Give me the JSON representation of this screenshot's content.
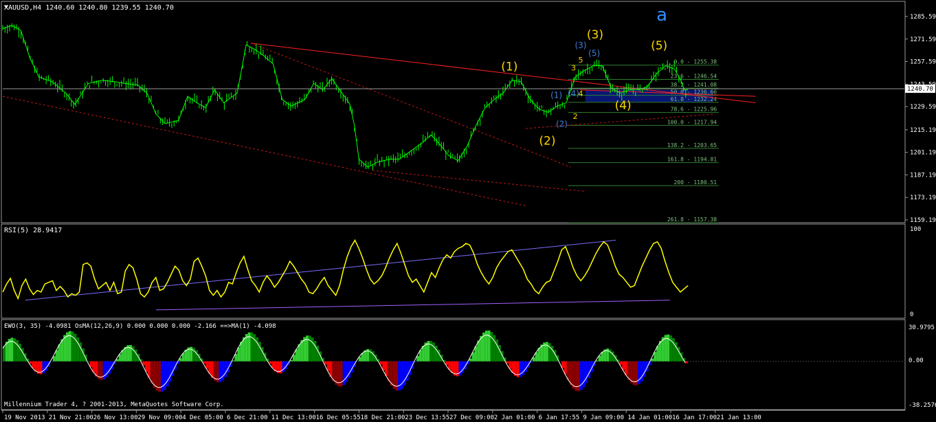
{
  "colors": {
    "background": "#000000",
    "frame": "#9a9a9a",
    "grid_text": "#ffffff",
    "bull_candle": "#00ff00",
    "price_line": "#9a9a9a",
    "trend_solid": "#ff2020",
    "trend_dashed": "#c01818",
    "fib": "#2f7f2f",
    "fib_label": "#7fbf7f",
    "wave_yellow": "#ffd700",
    "wave_blue": "#3f7fdf",
    "wave_a": "#2f8fff",
    "rsi_line": "#ffff00",
    "rsi_trend_upper": "#7a6cff",
    "rsi_trend_lower": "#a060ff",
    "ewo_bright_green": "#32cd32",
    "ewo_dark_green": "#008000",
    "ewo_blue": "#0000ff",
    "ewo_red": "#ff0000",
    "ewo_dark_red": "#8b0000",
    "ewo_signal": "#ffffff",
    "fib_zone": "#0a1a80"
  },
  "main_panel": {
    "title": "XAUUSD,H4  1240.60 1240.80 1239.55 1240.70",
    "current_price": "1240.70",
    "y_axis_ticks": [
      "1285.59",
      "1271.59",
      "1257.59",
      "1243.59",
      "1229.59",
      "1215.19",
      "1201.19",
      "1187.19",
      "1173.19",
      "1159.19"
    ],
    "fib_levels": [
      {
        "label": "0.0 - 1255.38",
        "price": 1255.38
      },
      {
        "label": "23.6 - 1246.54",
        "price": 1246.54
      },
      {
        "label": "38.2 - 1241.08",
        "price": 1241.08
      },
      {
        "label": "50.0 - 1236.66",
        "price": 1236.66
      },
      {
        "label": "61.8 - 1232.24",
        "price": 1232.24
      },
      {
        "label": "78.6 - 1225.96",
        "price": 1225.96
      },
      {
        "label": "100.0 - 1217.94",
        "price": 1217.94
      },
      {
        "label": "138.2 - 1203.65",
        "price": 1203.65
      },
      {
        "label": "161.8 - 1194.81",
        "price": 1194.81
      },
      {
        "label": "200 - 1180.51",
        "price": 1180.51
      },
      {
        "label": "261.8 - 1157.38",
        "price": 1157.38
      }
    ],
    "wave_labels": [
      {
        "text": "(1)",
        "style": "yellow",
        "price": 1252,
        "bar": 0.562
      },
      {
        "text": "(2)",
        "style": "yellow",
        "price": 1206,
        "bar": 0.604
      },
      {
        "text": "(3)",
        "style": "yellow",
        "price": 1272,
        "bar": 0.657
      },
      {
        "text": "(4)",
        "style": "yellow",
        "price": 1228,
        "bar": 0.688
      },
      {
        "text": "(5)",
        "style": "yellow",
        "price": 1265,
        "bar": 0.728
      },
      {
        "text": "a",
        "style": "a",
        "price": 1283,
        "bar": 0.731
      },
      {
        "text": "(3)",
        "style": "blue",
        "price": 1266,
        "bar": 0.641
      },
      {
        "text": "(5)",
        "style": "blue",
        "price": 1261,
        "bar": 0.656
      },
      {
        "text": "(1)",
        "style": "blue",
        "price": 1235,
        "bar": 0.614
      },
      {
        "text": "(2)",
        "style": "blue",
        "price": 1217,
        "bar": 0.62
      },
      {
        "text": "(4)",
        "style": "blue",
        "price": 1236,
        "bar": 0.633
      },
      {
        "text": "3",
        "style": "small",
        "price": 1252,
        "bar": 0.633
      },
      {
        "text": "5",
        "style": "small",
        "price": 1257,
        "bar": 0.641
      },
      {
        "text": "4",
        "style": "small",
        "price": 1236,
        "bar": 0.641
      },
      {
        "text": "2",
        "style": "small",
        "price": 1222,
        "bar": 0.635
      }
    ],
    "price_path": [
      [
        0.0,
        1278
      ],
      [
        0.01,
        1280
      ],
      [
        0.02,
        1277
      ],
      [
        0.03,
        1260
      ],
      [
        0.04,
        1248
      ],
      [
        0.055,
        1245
      ],
      [
        0.07,
        1238
      ],
      [
        0.08,
        1231
      ],
      [
        0.095,
        1244
      ],
      [
        0.11,
        1246
      ],
      [
        0.125,
        1245
      ],
      [
        0.135,
        1244
      ],
      [
        0.15,
        1243
      ],
      [
        0.16,
        1238
      ],
      [
        0.17,
        1225
      ],
      [
        0.18,
        1219
      ],
      [
        0.195,
        1221
      ],
      [
        0.205,
        1236
      ],
      [
        0.215,
        1232
      ],
      [
        0.225,
        1229
      ],
      [
        0.235,
        1240
      ],
      [
        0.245,
        1232
      ],
      [
        0.26,
        1238
      ],
      [
        0.27,
        1268
      ],
      [
        0.28,
        1265
      ],
      [
        0.29,
        1261
      ],
      [
        0.3,
        1256
      ],
      [
        0.31,
        1234
      ],
      [
        0.32,
        1230
      ],
      [
        0.335,
        1234
      ],
      [
        0.345,
        1244
      ],
      [
        0.355,
        1240
      ],
      [
        0.365,
        1247
      ],
      [
        0.375,
        1239
      ],
      [
        0.385,
        1231
      ],
      [
        0.39,
        1218
      ],
      [
        0.395,
        1197
      ],
      [
        0.405,
        1192
      ],
      [
        0.415,
        1195
      ],
      [
        0.43,
        1197
      ],
      [
        0.44,
        1197
      ],
      [
        0.455,
        1203
      ],
      [
        0.465,
        1207
      ],
      [
        0.475,
        1212
      ],
      [
        0.485,
        1206
      ],
      [
        0.495,
        1199
      ],
      [
        0.505,
        1196
      ],
      [
        0.515,
        1205
      ],
      [
        0.525,
        1218
      ],
      [
        0.535,
        1229
      ],
      [
        0.545,
        1234
      ],
      [
        0.555,
        1238
      ],
      [
        0.565,
        1246
      ],
      [
        0.575,
        1245
      ],
      [
        0.585,
        1234
      ],
      [
        0.595,
        1228
      ],
      [
        0.605,
        1226
      ],
      [
        0.615,
        1230
      ],
      [
        0.625,
        1232
      ],
      [
        0.635,
        1248
      ],
      [
        0.645,
        1252
      ],
      [
        0.655,
        1255
      ],
      [
        0.665,
        1255
      ],
      [
        0.675,
        1241
      ],
      [
        0.685,
        1238
      ],
      [
        0.695,
        1240
      ],
      [
        0.705,
        1240
      ],
      [
        0.715,
        1242
      ],
      [
        0.725,
        1250
      ],
      [
        0.735,
        1255
      ],
      [
        0.745,
        1253
      ],
      [
        0.752,
        1246
      ],
      [
        0.756,
        1240
      ],
      [
        0.76,
        1240
      ]
    ]
  },
  "rsi_panel": {
    "title": "RSI(5) 28.9417",
    "y_max_label": "100",
    "y_min_label": "0",
    "values": [
      28,
      38,
      45,
      30,
      20,
      36,
      44,
      32,
      25,
      30,
      28,
      38,
      40,
      42,
      30,
      35,
      30,
      22,
      26,
      24,
      28,
      62,
      64,
      60,
      44,
      32,
      36,
      40,
      30,
      40,
      26,
      28,
      54,
      62,
      58,
      44,
      26,
      22,
      28,
      40,
      46,
      30,
      32,
      40,
      50,
      60,
      55,
      42,
      36,
      44,
      66,
      70,
      60,
      48,
      30,
      24,
      30,
      22,
      28,
      40,
      38,
      52,
      64,
      72,
      56,
      42,
      36,
      28,
      40,
      48,
      42,
      34,
      40,
      48,
      56,
      66,
      60,
      52,
      44,
      38,
      28,
      26,
      32,
      40,
      46,
      36,
      30,
      24,
      36,
      56,
      72,
      84,
      92,
      82,
      70,
      56,
      44,
      38,
      42,
      48,
      58,
      70,
      80,
      88,
      76,
      62,
      48,
      40,
      44,
      36,
      28,
      40,
      52,
      46,
      58,
      68,
      74,
      70,
      78,
      82,
      84,
      88,
      86,
      76,
      62,
      52,
      44,
      38,
      46,
      58,
      66,
      72,
      78,
      80,
      72,
      64,
      56,
      44,
      38,
      30,
      26,
      34,
      40,
      42,
      54,
      66,
      80,
      84,
      72,
      58,
      48,
      42,
      48,
      56,
      66,
      76,
      84,
      90,
      86,
      74,
      60,
      50,
      46,
      40,
      34,
      36,
      48,
      60,
      70,
      80,
      88,
      90,
      82,
      66,
      52,
      40,
      34,
      28,
      32,
      36
    ]
  },
  "ewo_panel": {
    "title": "EWO(3, 35) -4.0981   OsMA(12,26,9) 0.000 0.000 0.000 -2.166   ==>MA(1) -4.098",
    "y_ticks": [
      "30.9795",
      "0.00",
      "-38.2576"
    ],
    "copyright": "Millennium Trader 4, ? 2001-2013, MetaQuotes Software Corp."
  },
  "x_axis_labels": [
    "19 Nov 2013",
    "21 Nov 21:00",
    "26 Nov 13:00",
    "29 Nov 09:00",
    "4 Dec 05:00",
    "6 Dec 21:00",
    "11 Dec 13:00",
    "16 Dec 05:55",
    "18 Dec 21:00",
    "23 Dec 13:55",
    "27 Dec 09:00",
    "2 Jan 01:00",
    "6 Jan 17:55",
    "9 Jan 09:00",
    "14 Jan 01:00",
    "16 Jan 17:00",
    "21 Jan 13:00"
  ],
  "chart_data": [
    {
      "type": "line",
      "title": "XAUUSD,H4  1240.60 1240.80 1239.55 1240.70",
      "ylim": [
        1159.19,
        1285.59
      ],
      "x": [
        "19 Nov 2013",
        "21 Nov 21:00",
        "26 Nov 13:00",
        "29 Nov 09:00",
        "4 Dec 05:00",
        "6 Dec 21:00",
        "11 Dec 13:00",
        "16 Dec 05:55",
        "18 Dec 21:00",
        "23 Dec 13:55",
        "27 Dec 09:00",
        "2 Jan 01:00",
        "6 Jan 17:55",
        "9 Jan 09:00",
        "14 Jan 01:00",
        "16 Jan 17:00",
        "21 Jan 13:00"
      ],
      "series": [
        {
          "values": [
            1278,
            1240,
            1244,
            1238,
            1228,
            1268,
            1234,
            1242,
            1194,
            1200,
            1208,
            1238,
            1230,
            1252,
            1238,
            1255,
            1240
          ]
        }
      ]
    },
    {
      "type": "line",
      "title": "RSI(5) 28.9417",
      "ylim": [
        0,
        100
      ]
    },
    {
      "type": "bar",
      "title": "EWO(3, 35) -4.0981",
      "ylim": [
        -38.2576,
        30.9795
      ]
    }
  ]
}
